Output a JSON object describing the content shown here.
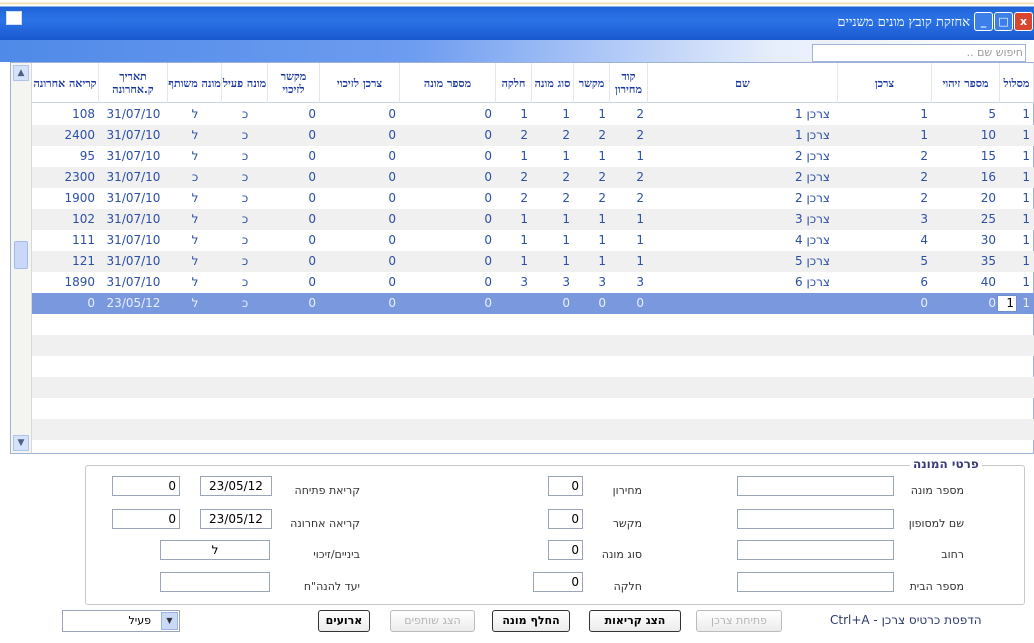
{
  "window": {
    "title": "אחזקת קובץ מונים משניים",
    "controls": {
      "min": "_",
      "max": "□",
      "close": "x"
    }
  },
  "search": {
    "placeholder": "חיפוש שם .."
  },
  "grid": {
    "columns": {
      "route": "מסלול",
      "id_number": "מספר זיהוי",
      "consumer": "צרכן",
      "name": "שם",
      "supply_code": "קוד מחירון",
      "link": "מקשר",
      "meter_type": "סוג מונה",
      "part": "חלקה",
      "meter_number": "מספר מונה",
      "consumer_credit": "צרכן לזיכוי",
      "link_credit": "מקשר לזיכוי",
      "active_meter": "מונה פעיל",
      "shared_meter": "מונה משותף",
      "last_date": "תאריך ק.אחרונה",
      "last_reading": "קריאה אחרונה"
    },
    "rows": [
      {
        "route": "1",
        "id": "5",
        "consumer": "1",
        "name": "צרכן 1",
        "code": "2",
        "link": "1",
        "type": "1",
        "part": "1",
        "meter": "0",
        "cc": "0",
        "lc": "0",
        "active": "כ",
        "shared": "ל",
        "date": "31/07/10",
        "reading": "108"
      },
      {
        "route": "1",
        "id": "10",
        "consumer": "1",
        "name": "צרכן 1",
        "code": "2",
        "link": "2",
        "type": "2",
        "part": "2",
        "meter": "0",
        "cc": "0",
        "lc": "0",
        "active": "כ",
        "shared": "ל",
        "date": "31/07/10",
        "reading": "2400"
      },
      {
        "route": "1",
        "id": "15",
        "consumer": "2",
        "name": "צרכן 2",
        "code": "1",
        "link": "1",
        "type": "1",
        "part": "1",
        "meter": "0",
        "cc": "0",
        "lc": "0",
        "active": "כ",
        "shared": "ל",
        "date": "31/07/10",
        "reading": "95"
      },
      {
        "route": "1",
        "id": "16",
        "consumer": "2",
        "name": "צרכן 2",
        "code": "2",
        "link": "2",
        "type": "2",
        "part": "2",
        "meter": "0",
        "cc": "0",
        "lc": "0",
        "active": "כ",
        "shared": "כ",
        "date": "31/07/10",
        "reading": "2300"
      },
      {
        "route": "1",
        "id": "20",
        "consumer": "2",
        "name": "צרכן 2",
        "code": "2",
        "link": "2",
        "type": "2",
        "part": "2",
        "meter": "0",
        "cc": "0",
        "lc": "0",
        "active": "כ",
        "shared": "ל",
        "date": "31/07/10",
        "reading": "1900"
      },
      {
        "route": "1",
        "id": "25",
        "consumer": "3",
        "name": "צרכן 3",
        "code": "1",
        "link": "1",
        "type": "1",
        "part": "1",
        "meter": "0",
        "cc": "0",
        "lc": "0",
        "active": "כ",
        "shared": "ל",
        "date": "31/07/10",
        "reading": "102"
      },
      {
        "route": "1",
        "id": "30",
        "consumer": "4",
        "name": "צרכן 4",
        "code": "1",
        "link": "1",
        "type": "1",
        "part": "1",
        "meter": "0",
        "cc": "0",
        "lc": "0",
        "active": "כ",
        "shared": "ל",
        "date": "31/07/10",
        "reading": "111"
      },
      {
        "route": "1",
        "id": "35",
        "consumer": "5",
        "name": "צרכן 5",
        "code": "1",
        "link": "1",
        "type": "1",
        "part": "1",
        "meter": "0",
        "cc": "0",
        "lc": "0",
        "active": "כ",
        "shared": "ל",
        "date": "31/07/10",
        "reading": "121"
      },
      {
        "route": "1",
        "id": "40",
        "consumer": "6",
        "name": "צרכן 6",
        "code": "3",
        "link": "3",
        "type": "3",
        "part": "3",
        "meter": "0",
        "cc": "0",
        "lc": "0",
        "active": "כ",
        "shared": "ל",
        "date": "31/07/10",
        "reading": "1890"
      },
      {
        "route": "1",
        "id": "0",
        "consumer": "0",
        "name": "",
        "code": "0",
        "link": "0",
        "type": "0",
        "part": "",
        "meter": "0",
        "cc": "0",
        "lc": "0",
        "active": "כ",
        "shared": "ל",
        "date": "23/05/12",
        "reading": "0"
      }
    ],
    "selected_row_index": 9
  },
  "details": {
    "legend": "פרטי המונה",
    "meter_number": {
      "label": "מספר מונה",
      "value": ""
    },
    "terminal_name": {
      "label": "שם למסופון",
      "value": ""
    },
    "street": {
      "label": "רחוב",
      "value": ""
    },
    "house_number": {
      "label": "מספר הבית",
      "value": ""
    },
    "price_list": {
      "label": "מחירון",
      "value": "0"
    },
    "link": {
      "label": "מקשר",
      "value": "0"
    },
    "meter_type": {
      "label": "סוג מונה",
      "value": "0"
    },
    "part": {
      "label": "חלקה",
      "value": "0"
    },
    "open_reading": {
      "label": "קריאת פתיחה",
      "date": "23/05/12",
      "value": "0"
    },
    "last_reading": {
      "label": "קריאה אחרונה",
      "date": "23/05/12",
      "value": "0"
    },
    "intermediate_credit": {
      "label": "ביניים/זיכוי",
      "value": "ל"
    },
    "management_target": {
      "label": "יעד להנה\"ח",
      "value": ""
    }
  },
  "buttons": {
    "open_consumer": "פתיחת צרכן",
    "show_readings": "הצג קריאות",
    "replace_meter": "החלף מונה",
    "show_partners": "הצג שותפים",
    "events": "ארועים"
  },
  "shortcut_hint": "Ctrl+A - הדפסת כרטיס צרכן",
  "status_filter": {
    "value": "פעיל"
  }
}
